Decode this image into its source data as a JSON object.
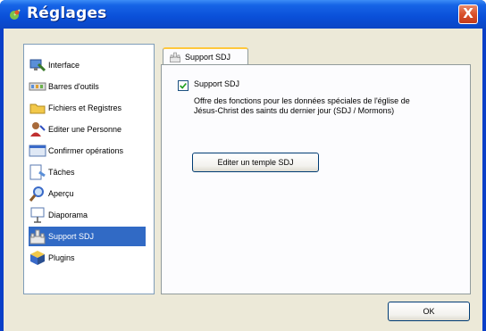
{
  "window": {
    "title": "Réglages",
    "close_label": "X"
  },
  "sidebar": {
    "items": [
      {
        "label": "Interface",
        "icon": "interface-icon"
      },
      {
        "label": "Barres d'outils",
        "icon": "toolbars-icon"
      },
      {
        "label": "Fichiers et Registres",
        "icon": "folder-icon"
      },
      {
        "label": "Editer une Personne",
        "icon": "person-icon"
      },
      {
        "label": "Confirmer opérations",
        "icon": "confirm-icon"
      },
      {
        "label": "Tâches",
        "icon": "tasks-icon"
      },
      {
        "label": "Aperçu",
        "icon": "magnifier-icon"
      },
      {
        "label": "Diaporama",
        "icon": "slideshow-icon"
      },
      {
        "label": "Support SDJ",
        "icon": "temple-icon",
        "selected": true
      },
      {
        "label": "Plugins",
        "icon": "plugins-icon"
      }
    ]
  },
  "panel": {
    "tab_label": "Support SDJ",
    "checkbox_label": "Support SDJ",
    "checkbox_checked": true,
    "description_line1": "Offre des fonctions pour les données spéciales de l'église de",
    "description_line2": "Jésus-Christ des saints du dernier jour (SDJ / Mormons)",
    "edit_temple_button": "Editer un temple SDJ"
  },
  "footer": {
    "ok_button": "OK"
  },
  "colors": {
    "titlebar": "#0a4fd8",
    "selection": "#316ac5",
    "client": "#ece9d8"
  }
}
